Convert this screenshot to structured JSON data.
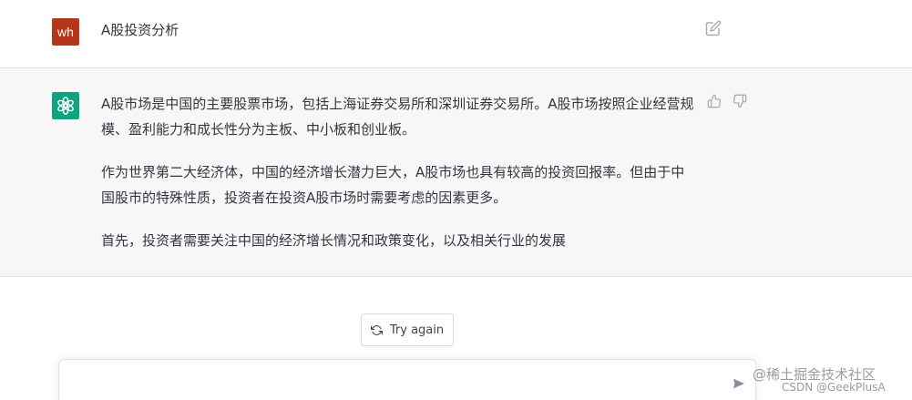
{
  "user_message": {
    "avatar_text": "wh",
    "avatar_color": "#b5361b",
    "text": "A股投资分析",
    "edit_icon": "edit-icon"
  },
  "assistant_message": {
    "avatar_icon": "openai-logo-icon",
    "avatar_color": "#10a37f",
    "paragraphs": [
      "A股市场是中国的主要股票市场，包括上海证券交易所和深圳证券交易所。A股市场按照企业经营规模、盈利能力和成长性分为主板、中小板和创业板。",
      "作为世界第二大经济体，中国的经济增长潜力巨大，A股市场也具有较高的投资回报率。但由于中国股市的特殊性质，投资者在投资A股市场时需要考虑的因素更多。",
      "首先，投资者需要关注中国的经济增长情况和政策变化，以及相关行业的发展"
    ],
    "feedback": [
      "thumbs-up-icon",
      "thumbs-down-icon"
    ]
  },
  "try_again": {
    "label": "Try again",
    "icon": "refresh-icon"
  },
  "composer": {
    "value": "",
    "placeholder": "",
    "send_icon": "send-icon"
  },
  "watermark": {
    "line1": "@稀土掘金技术社区",
    "line2": "CSDN @GeekPlusA"
  }
}
